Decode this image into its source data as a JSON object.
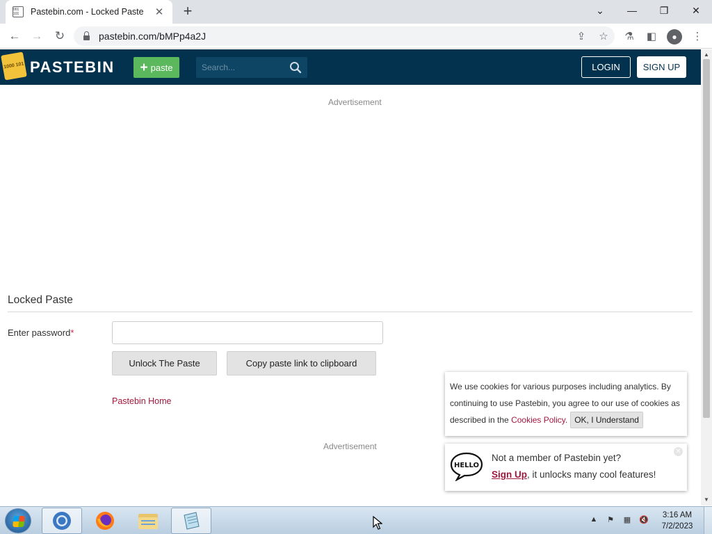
{
  "browser": {
    "tab_title": "Pastebin.com - Locked Paste",
    "url": "pastebin.com/bMPp4a2J",
    "favicon_text": "001 101"
  },
  "header": {
    "logo_text": "PASTEBIN",
    "logo_badge": "1000 101",
    "paste_button": "paste",
    "search_placeholder": "Search...",
    "login_button": "LOGIN",
    "signup_button": "SIGN UP",
    "colors": {
      "background": "#02324e",
      "paste_button": "#5cb85c"
    }
  },
  "ads": {
    "top_label": "Advertisement",
    "bottom_label": "Advertisement"
  },
  "locked_paste": {
    "title": "Locked Paste",
    "password_label": "Enter password",
    "required_marker": "*",
    "password_value": "",
    "unlock_button": "Unlock The Paste",
    "copy_button": "Copy paste link to clipboard",
    "home_link": "Pastebin Home"
  },
  "cookie_notice": {
    "text_before_link": "We use cookies for various purposes including analytics. By continuing to use Pastebin, you agree to our use of cookies as described in the ",
    "link_text": "Cookies Policy",
    "text_after_link": ".",
    "ok_button": "OK, I Understand"
  },
  "signup_prompt": {
    "icon_text": "HELLO",
    "line1": "Not a member of Pastebin yet?",
    "signup_link": "Sign Up",
    "line2_rest": ", it unlocks many cool features!"
  },
  "taskbar": {
    "apps": [
      "chrome-icon",
      "firefox-icon",
      "file-explorer-icon",
      "notepad-icon"
    ],
    "active_app": "chrome-icon",
    "clock_time": "3:16 AM",
    "clock_date": "7/2/2023"
  }
}
